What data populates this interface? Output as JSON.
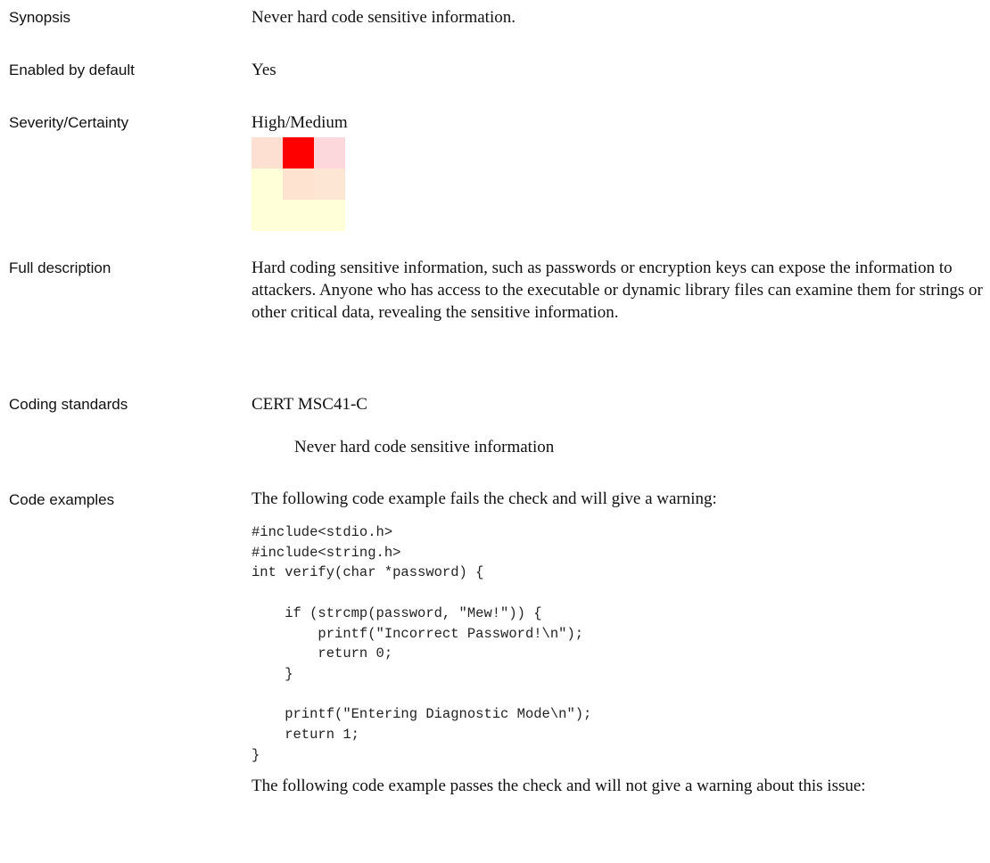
{
  "rows": {
    "synopsis": {
      "label": "Synopsis",
      "value": "Never hard code sensitive information."
    },
    "enabled": {
      "label": "Enabled by default",
      "value": "Yes"
    },
    "severity": {
      "label": "Severity/Certainty",
      "value": "High/Medium"
    },
    "full_description": {
      "label": "Full description",
      "value": " Hard coding sensitive information, such as passwords  or encryption keys can expose the information to  attackers. Anyone who has access to the executable or  dynamic library files can examine them for strings or  other critical data, revealing the sensitive information."
    },
    "coding_standards": {
      "label": "Coding standards",
      "standard": "CERT MSC41-C",
      "standard_title": "Never hard code sensitive information"
    },
    "code_examples": {
      "label": "Code examples",
      "fail_intro": "The following code example fails the check and will give a warning:",
      "fail_code": "#include<stdio.h>\n#include<string.h>\nint verify(char *password) {\n\n    if (strcmp(password, \"Mew!\")) {\n        printf(\"Incorrect Password!\\n\");\n        return 0;\n    }\n\n    printf(\"Entering Diagnostic Mode\\n\");\n    return 1;\n}",
      "pass_intro": "The following code example passes the check and will not give a warning about this issue:"
    }
  },
  "severity_matrix": {
    "highlighted": "High/Medium",
    "colors": [
      [
        "#fde0d2",
        "#ff0000",
        "#fcd7dc"
      ],
      [
        "#ffffd8",
        "#fde3d0",
        "#fde6d3"
      ],
      [
        "#ffffd8",
        "#ffffd8",
        "#ffffd8"
      ]
    ]
  }
}
